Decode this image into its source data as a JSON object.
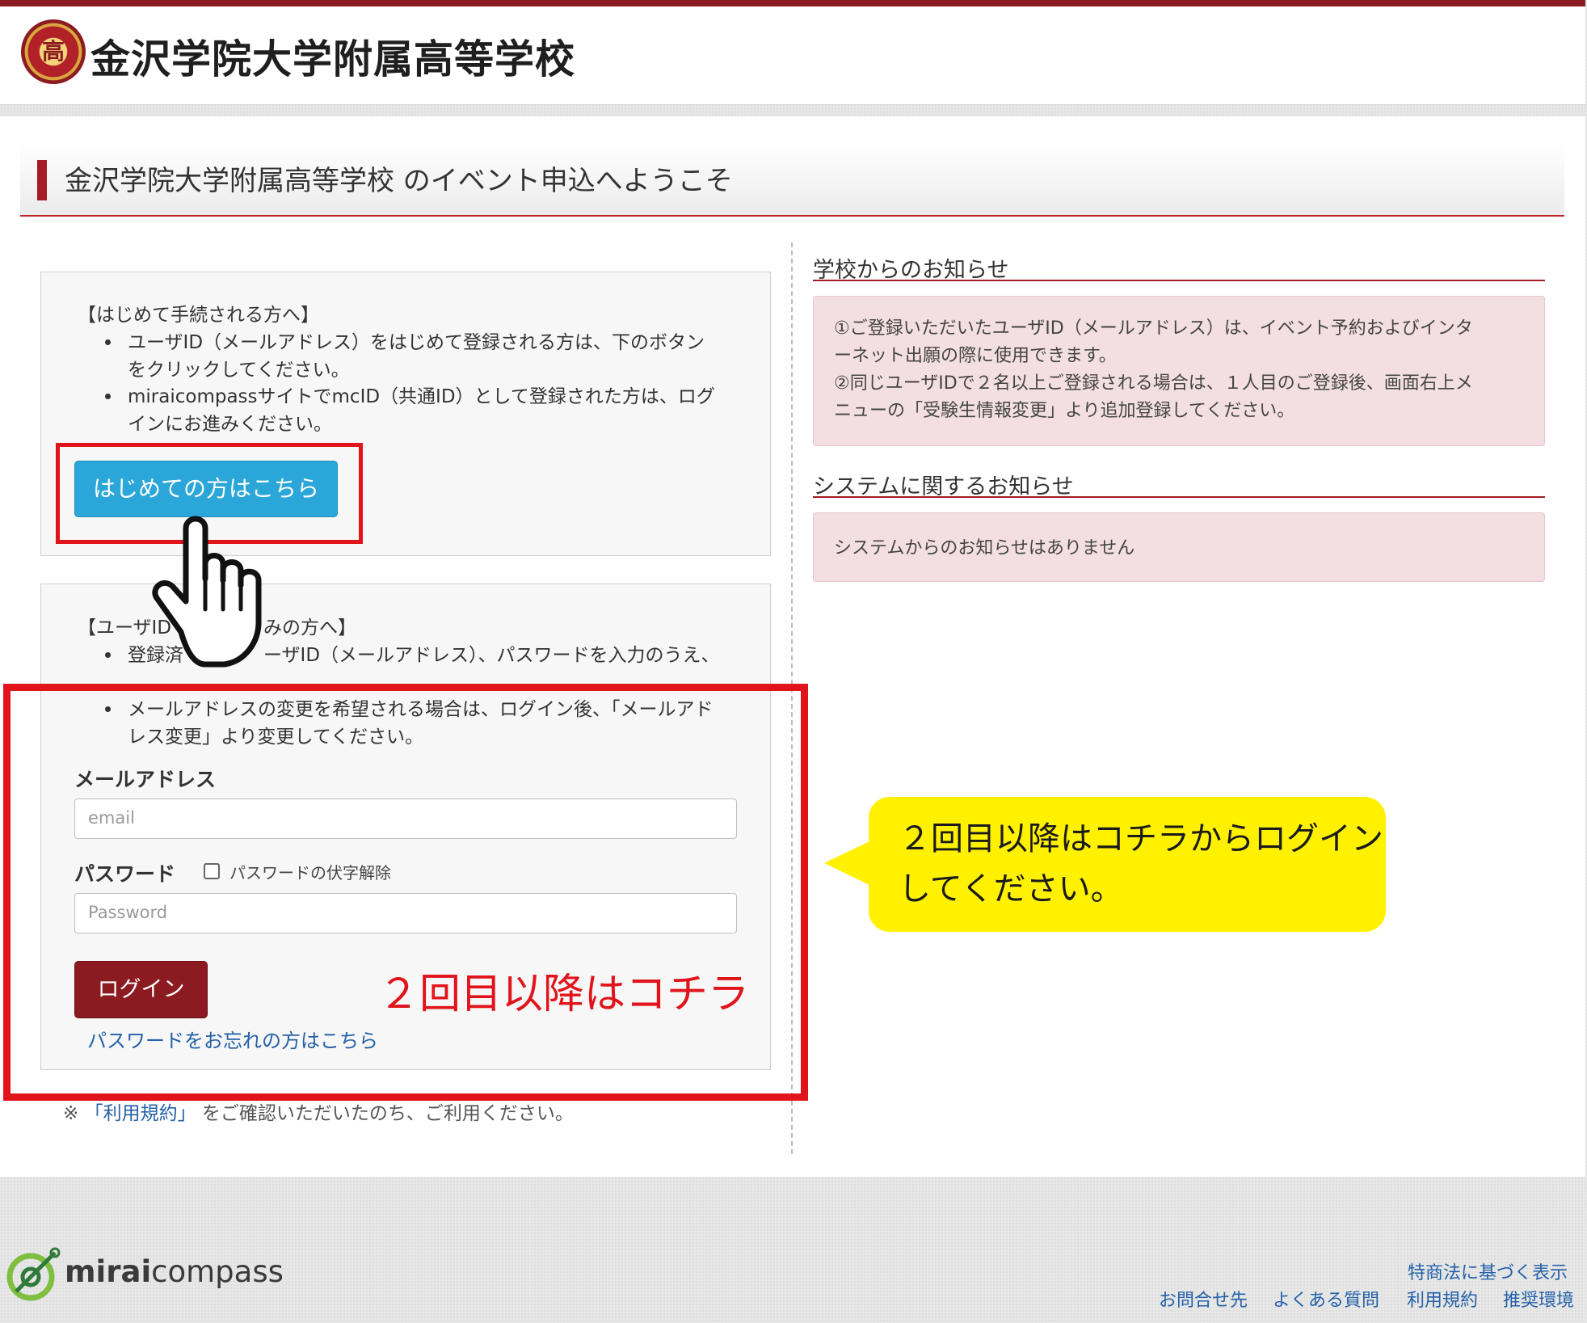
{
  "header": {
    "school_name": "金沢学院大学附属高等学校",
    "emblem_char": "高"
  },
  "welcome": {
    "title": "金沢学院大学附属高等学校 のイベント申込へようこそ"
  },
  "first_time": {
    "heading": "【はじめて手続される方へ】",
    "bullets": [
      [
        "ユーザID（メールアドレス）をはじめて登録される方は、下のボタン",
        "をクリックしてください。"
      ],
      [
        "miraicompassサイトでmcID（共通ID）として登録された方は、ログ",
        "インにお進みください。"
      ]
    ],
    "button_label": "はじめての方はこちら"
  },
  "login": {
    "heading_left": "【ユーザID",
    "heading_right": "みの方へ】",
    "bullet1_left": "登録済",
    "bullet1_right": "ーザID（メールアドレス）、パスワードを入力のうえ、",
    "bullet2": [
      "メールアドレスの変更を希望される場合は、ログイン後、「メールアド",
      "レス変更」より変更してください。"
    ],
    "email_label": "メールアドレス",
    "email_placeholder": "email",
    "password_label": "パスワード",
    "show_password_label": "パスワードの伏字解除",
    "password_placeholder": "Password",
    "button_label": "ログイン",
    "forgot_link": "パスワードをお忘れの方はこちら"
  },
  "terms_note": {
    "prefix": "※",
    "link": "「利用規約」",
    "suffix": "をご確認いただいたのち、ご利用ください。"
  },
  "notices": {
    "school_heading": "学校からのお知らせ",
    "school_lines": [
      "①ご登録いただいたユーザID（メールアドレス）は、イベント予約およびインタ",
      "ーネット出願の際に使用できます。",
      "②同じユーザIDで２名以上ご登録される場合は、１人目のご登録後、画面右上メ",
      "ニューの「受験生情報変更」より追加登録してください。"
    ],
    "system_heading": "システムに関するお知らせ",
    "system_text": "システムからのお知らせはありません"
  },
  "annotations": {
    "login_label": "２回目以降はコチラ",
    "callout_lines": [
      "２回目以降はコチラからログイン",
      "してください。"
    ]
  },
  "footer": {
    "logo_bold": "mirai",
    "logo_regular": "compass",
    "link_tokushoho": "特商法に基づく表示",
    "link_contact": "お問合せ先",
    "link_faq": "よくある質問",
    "link_terms": "利用規約",
    "link_env": "推奨環境"
  },
  "colors": {
    "accent_red": "#a51c25",
    "first_button": "#2aa6d8",
    "login_button": "#8b1a21",
    "annotation_red": "#e1141b",
    "callout_yellow": "#fff100",
    "notice_bg": "#f3dfe1"
  }
}
